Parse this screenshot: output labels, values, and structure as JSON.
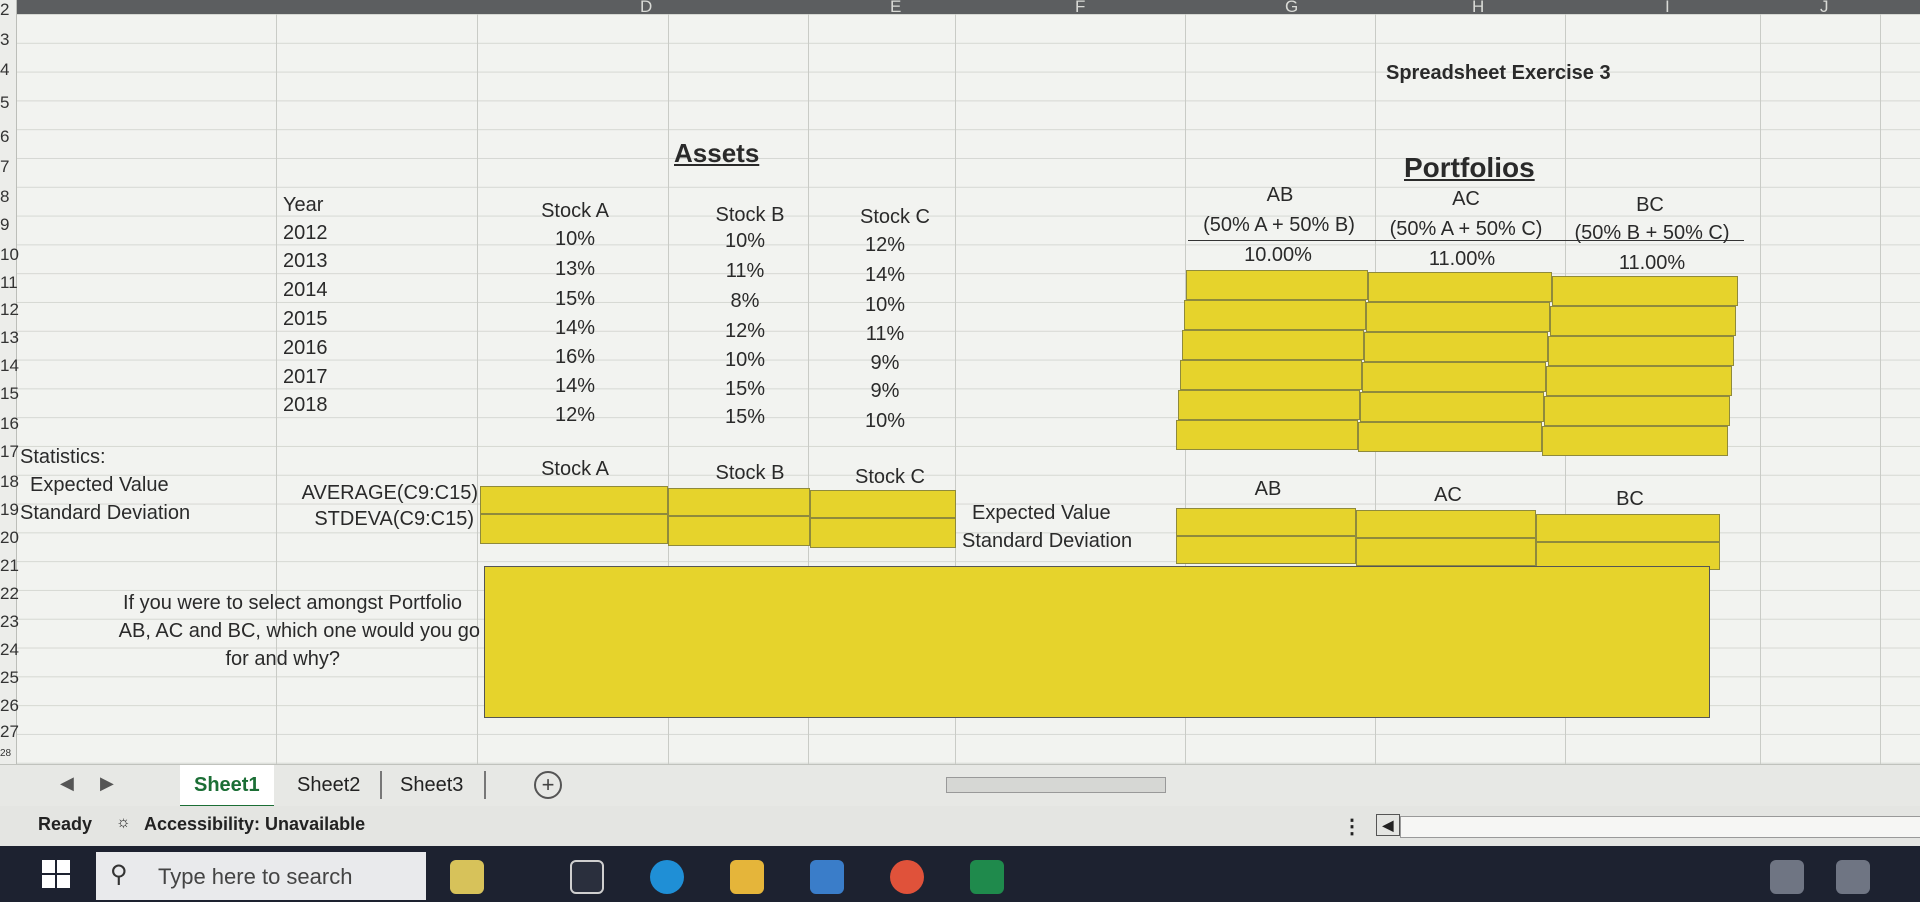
{
  "column_letters": [
    "D",
    "E",
    "F",
    "G",
    "H",
    "I",
    "J"
  ],
  "row_numbers": [
    "2",
    "3",
    "4",
    "5",
    "6",
    "7",
    "8",
    "9",
    "10",
    "11",
    "12",
    "13",
    "14",
    "15",
    "16",
    "17",
    "18",
    "19",
    "20",
    "21",
    "22",
    "23",
    "24",
    "25",
    "26",
    "27",
    "28"
  ],
  "sheet": {
    "title": "Spreadsheet Exercise 3",
    "assets_header": "Assets",
    "portfolios_header": "Portfolios",
    "year_header": "Year",
    "stock_headers": [
      "Stock A",
      "Stock B",
      "Stock C"
    ],
    "years": [
      "2012",
      "2013",
      "2014",
      "2015",
      "2016",
      "2017",
      "2018"
    ],
    "stock_a": [
      "10%",
      "13%",
      "15%",
      "14%",
      "16%",
      "14%",
      "12%"
    ],
    "stock_b": [
      "10%",
      "11%",
      "8%",
      "12%",
      "10%",
      "15%",
      "15%"
    ],
    "stock_c": [
      "12%",
      "14%",
      "10%",
      "11%",
      "9%",
      "9%",
      "10%"
    ],
    "portfolio_names": [
      "AB",
      "AC",
      "BC"
    ],
    "portfolio_weights": [
      "(50% A + 50% B)",
      "(50% A + 50% C)",
      "(50% B + 50% C)"
    ],
    "portfolio_first_values": [
      "10.00%",
      "11.00%",
      "11.00%"
    ],
    "statistics_label": "Statistics:",
    "expected_value_label": "Expected Value",
    "std_dev_label": "Standard Deviation",
    "avg_formula": "AVERAGE(C9:C15)",
    "stdev_formula": "STDEVA(C9:C15)",
    "stats_stock_headers": [
      "Stock A",
      "Stock B",
      "Stock C"
    ],
    "portfolio_stats_headers": [
      "AB",
      "AC",
      "BC"
    ],
    "portfolio_ev_label": "Expected Value",
    "portfolio_sd_label": "Standard Deviation",
    "question_line1": "If you were to select amongst Portfolio",
    "question_line2": "AB, AC and BC, which one would you go",
    "question_line3": "for and why?"
  },
  "tabs": [
    "Sheet1",
    "Sheet2",
    "Sheet3"
  ],
  "active_tab": "Sheet1",
  "status": {
    "ready": "Ready",
    "accessibility": "Accessibility: Unavailable"
  },
  "taskbar": {
    "search_placeholder": "Type here to search"
  },
  "colors": {
    "highlight_yellow": "#e6d32c",
    "active_tab_green": "#1b6e35"
  }
}
